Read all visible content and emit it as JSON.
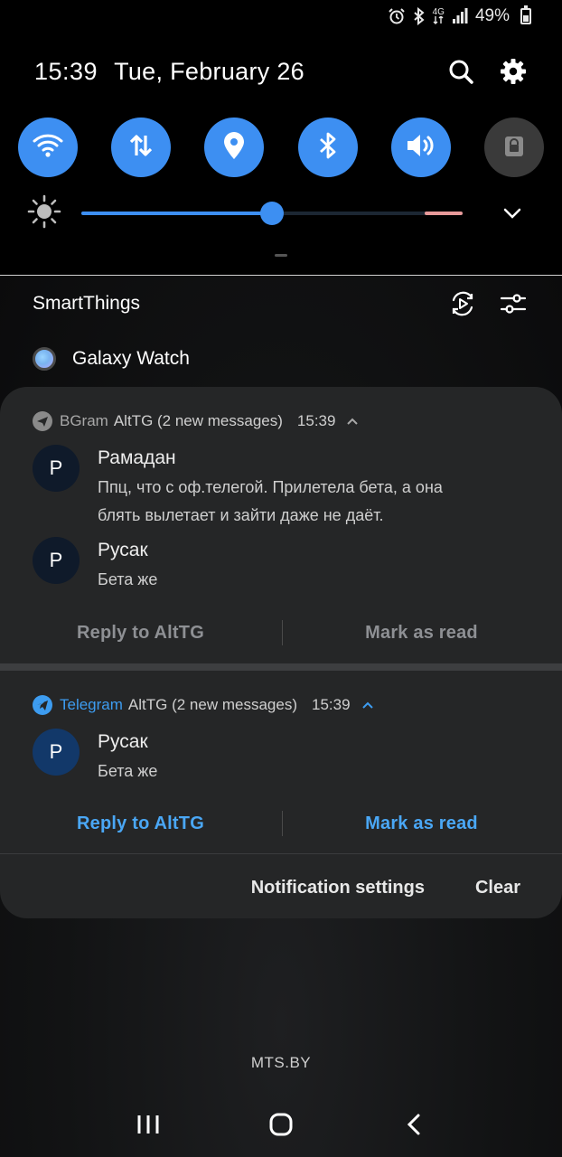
{
  "status_bar": {
    "network": "4G",
    "battery": "49%",
    "battery_level": 0.49,
    "icons": [
      "alarm-icon",
      "bluetooth-icon",
      "network-4g-icon",
      "signal-icon",
      "battery-icon"
    ]
  },
  "header": {
    "time": "15:39",
    "date": "Tue, February 26",
    "icons": [
      "search-icon",
      "settings-gear-icon"
    ]
  },
  "quick_toggles": [
    {
      "name": "wifi",
      "icon": "wifi-icon",
      "state": "on"
    },
    {
      "name": "mobile-data",
      "icon": "data-arrows-icon",
      "state": "on"
    },
    {
      "name": "location",
      "icon": "location-pin-icon",
      "state": "on"
    },
    {
      "name": "bluetooth",
      "icon": "bluetooth-icon",
      "state": "on"
    },
    {
      "name": "sound",
      "icon": "volume-icon",
      "state": "on"
    },
    {
      "name": "screen-lock",
      "icon": "lock-icon",
      "state": "off"
    }
  ],
  "brightness": {
    "level": 0.5,
    "icons": [
      "brightness-sun-icon",
      "chevron-down-icon"
    ]
  },
  "smartthings": {
    "title": "SmartThings",
    "device": "Galaxy Watch",
    "icons": [
      "smartthings-scan-icon",
      "smartthings-settings-icon"
    ]
  },
  "notifications": [
    {
      "app": "BGram",
      "channel": "AltTG (2 new messages)",
      "time": "15:39",
      "app_color": "#a8a8a8",
      "icon": "bgram-plane-icon",
      "messages": [
        {
          "avatar": "P",
          "sender": "Рамадан",
          "text_lines": [
            "Ппц, что с оф.телегой. Прилетела бета, а она",
            "блять вылетает и зайти даже не даёт."
          ]
        },
        {
          "avatar": "P",
          "sender": "Русак",
          "text_lines": [
            "Бета же"
          ]
        }
      ],
      "actions": [
        "Reply to AltTG",
        "Mark as read"
      ],
      "action_color": "#8e9094",
      "avatar_bg": "#0f1a2a"
    },
    {
      "app": "Telegram",
      "channel": "AltTG (2 new messages)",
      "time": "15:39",
      "app_color": "#3d9cf0",
      "icon": "telegram-plane-icon",
      "messages": [
        {
          "avatar": "P",
          "sender": "Русак",
          "text_lines": [
            "Бета же"
          ]
        }
      ],
      "actions": [
        "Reply to AltTG",
        "Mark as read"
      ],
      "action_color": "#4aa7f5",
      "avatar_bg": "#123869"
    }
  ],
  "footer": {
    "settings": "Notification settings",
    "clear": "Clear"
  },
  "operator": "MTS.BY",
  "navbar": {
    "icons": [
      "recent-apps-icon",
      "home-icon",
      "back-icon"
    ]
  }
}
